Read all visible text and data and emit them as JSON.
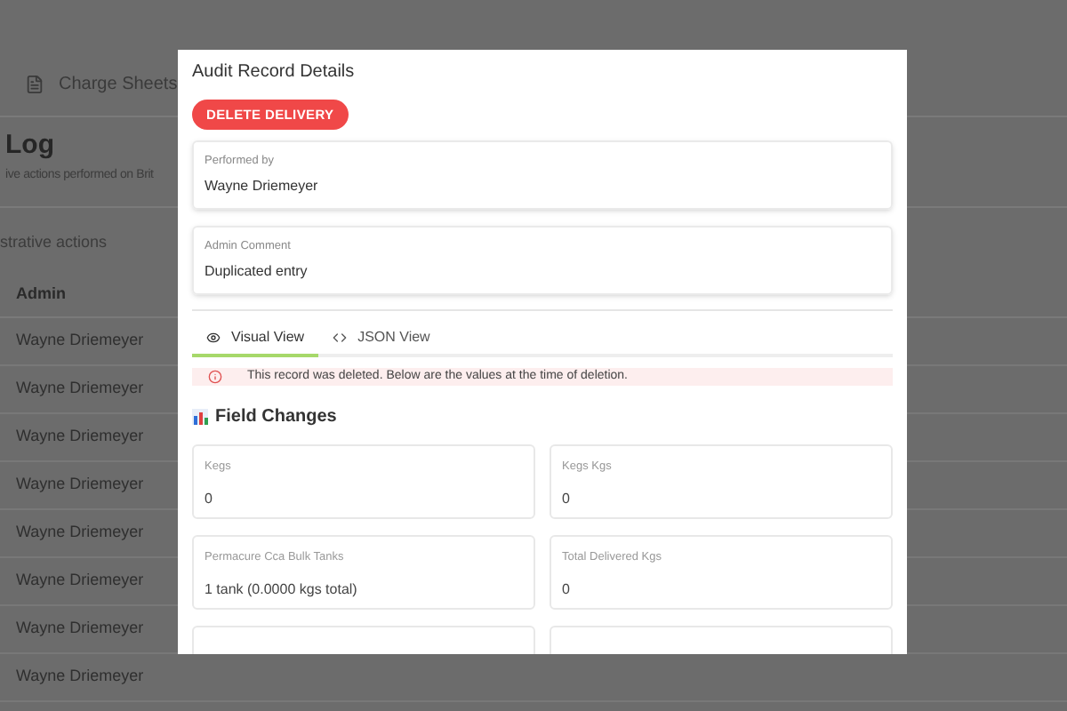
{
  "background": {
    "toolbar_item": "Charge Sheets",
    "heading": "Log",
    "subtitle": "ive actions performed on Brit",
    "section": "strative actions",
    "table": {
      "columns": [
        "Admin"
      ],
      "rows": [
        [
          "Wayne Driemeyer"
        ],
        [
          "Wayne Driemeyer"
        ],
        [
          "Wayne Driemeyer"
        ],
        [
          "Wayne Driemeyer"
        ],
        [
          "Wayne Driemeyer"
        ],
        [
          "Wayne Driemeyer"
        ],
        [
          "Wayne Driemeyer"
        ],
        [
          "Wayne Driemeyer"
        ]
      ]
    }
  },
  "dialog": {
    "title": "Audit Record Details",
    "badge": "DELETE DELIVERY",
    "info": [
      {
        "label": "Performed by",
        "value": "Wayne Driemeyer"
      },
      {
        "label": "Admin Comment",
        "value": "Duplicated entry"
      }
    ],
    "tabs": [
      {
        "label": "Visual View",
        "selected": true,
        "kind": "eye"
      },
      {
        "label": "JSON View",
        "selected": false,
        "kind": "code"
      }
    ],
    "alert": "This record was deleted. Below are the values at the time of deletion.",
    "section_title": "Field Changes",
    "fields": [
      {
        "label": "Kegs",
        "value": "0"
      },
      {
        "label": "Kegs Kgs",
        "value": "0"
      },
      {
        "label": "Permacure Cca Bulk Tanks",
        "value": "1 tank (0.0000 kgs total)"
      },
      {
        "label": "Total Delivered Kgs",
        "value": "0"
      }
    ]
  }
}
